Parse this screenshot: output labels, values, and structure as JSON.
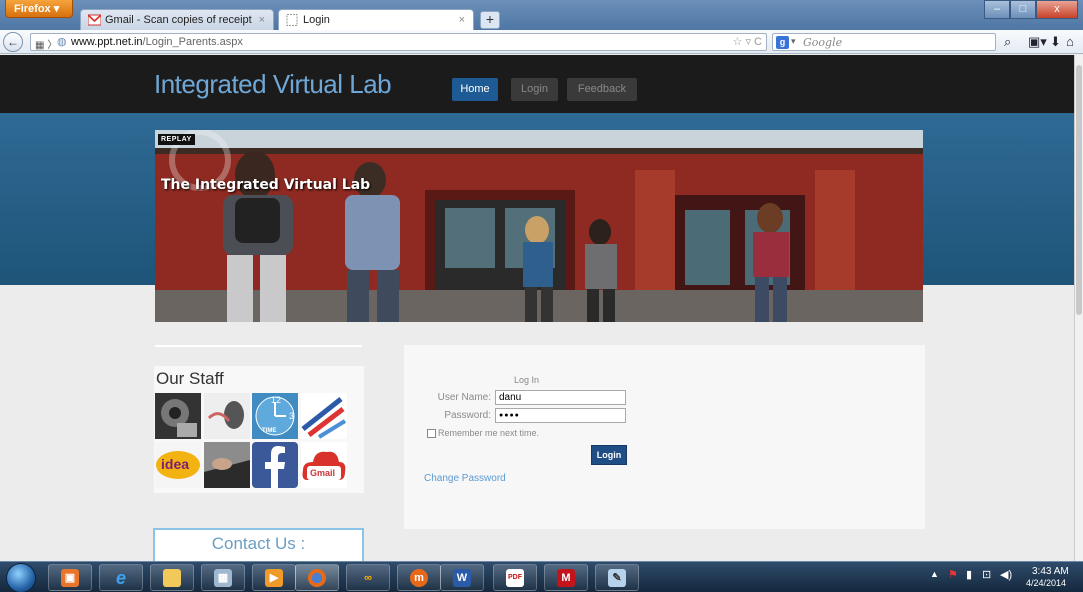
{
  "browser": {
    "menu_label": "Firefox",
    "tabs": [
      {
        "title": "Gmail - Scan copies of receipt",
        "close": "×"
      },
      {
        "title": "Login",
        "close": "×"
      }
    ],
    "new_tab": "+",
    "window_controls": {
      "minimize": "–",
      "maximize": "□",
      "close": "x"
    },
    "back": "←",
    "url_domain": "www.ppt.net.in",
    "url_path": "/Login_Parents.aspx",
    "url_controls": "☆ ▿ C",
    "search_engine": "g",
    "search_placeholder": "Google",
    "toolbar_icons": [
      "search-icon",
      "bookmarks-icon",
      "download-icon",
      "home-icon"
    ]
  },
  "site": {
    "title": "Integrated Virtual Lab",
    "nav": [
      "Home",
      "Login",
      "Feedback"
    ],
    "hero": {
      "badge": "REPLAY",
      "caption": "The Integrated Virtual Lab"
    },
    "staff": {
      "title": "Our Staff",
      "tiles": [
        "idea",
        "Gmail",
        "12",
        "3",
        "TIME"
      ]
    },
    "contact": {
      "title": "Contact Us :"
    },
    "login": {
      "heading": "Log In",
      "username_label": "User Name:",
      "username_value": "danu",
      "password_label": "Password:",
      "password_value": "●●●●",
      "remember_label": "Remember me next time.",
      "submit_label": "Login",
      "change_password": "Change Password"
    }
  },
  "taskbar": {
    "apps": [
      "explorer",
      "internet-explorer",
      "folder",
      "calculator",
      "media",
      "firefox",
      "ccleaner",
      "moodle",
      "word",
      "pdf",
      "mcafee",
      "paint"
    ],
    "time": "3:43 AM",
    "date": "4/24/2014"
  },
  "colors": {
    "header_bg": "#1b1b1b",
    "title_blue": "#6fa7d6",
    "nav_active": "#1e5b94",
    "banner_blue": "#2f6a95",
    "login_button": "#1f4e86",
    "link_blue": "#5b9bd2"
  }
}
